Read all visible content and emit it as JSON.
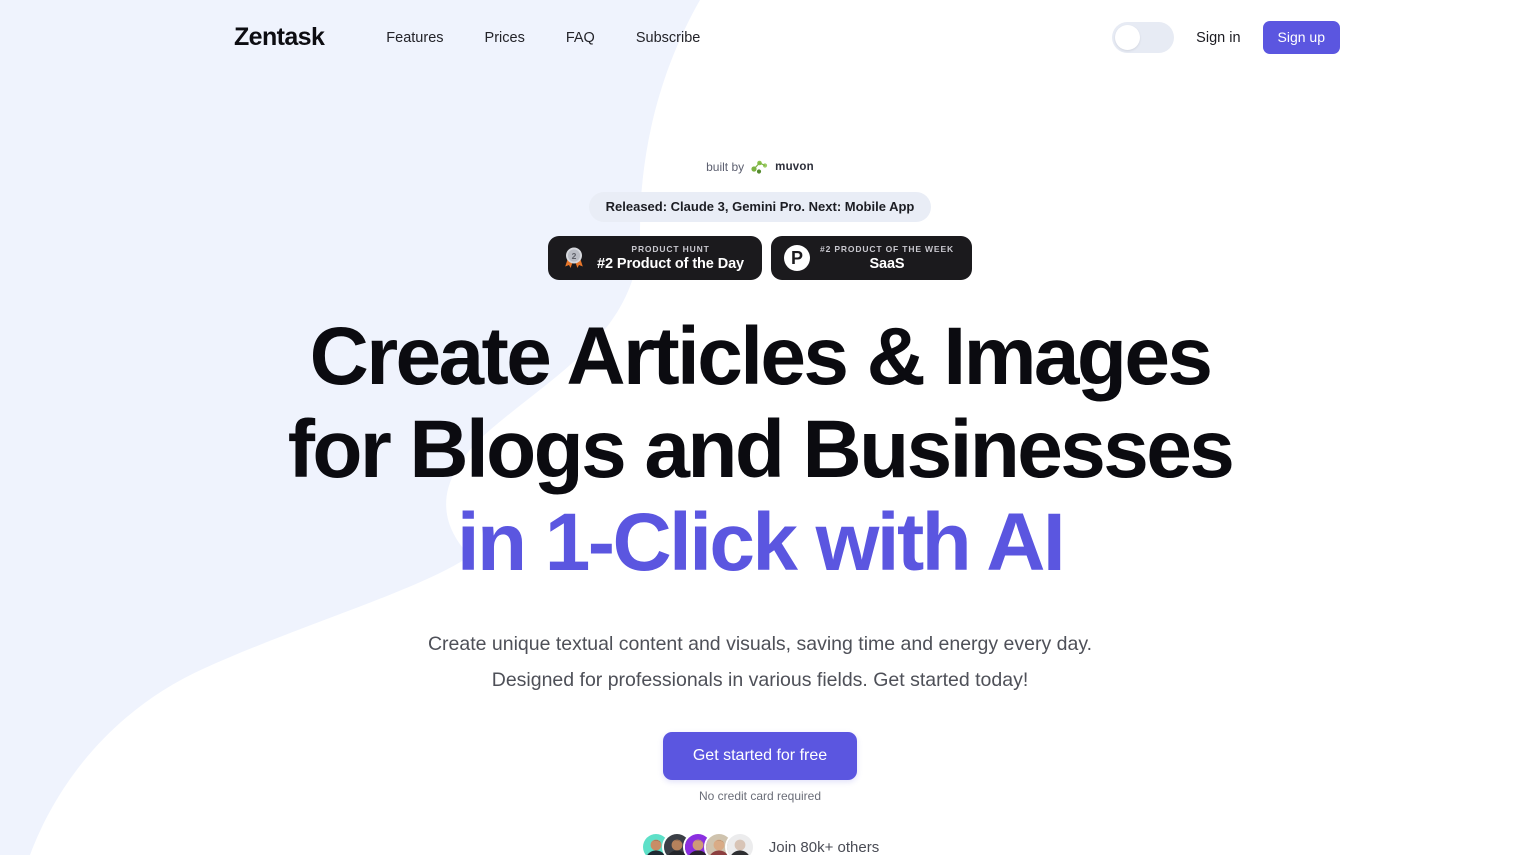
{
  "header": {
    "brand": "Zentask",
    "nav": [
      {
        "label": "Features"
      },
      {
        "label": "Prices"
      },
      {
        "label": "FAQ"
      },
      {
        "label": "Subscribe"
      }
    ],
    "theme_toggle": {
      "icon": "toggle-switch-icon",
      "state": "off"
    },
    "signin_label": "Sign in",
    "signup_label": "Sign up"
  },
  "hero": {
    "built_by_prefix": "built by",
    "built_by_brand": "muvon",
    "built_by_icon": "muvon-logo-icon",
    "release_pill": "Released: Claude 3, Gemini Pro. Next: Mobile App",
    "badges": [
      {
        "icon": "medal-2-icon",
        "kicker": "PRODUCT HUNT",
        "title": "#2 Product of the Day"
      },
      {
        "icon": "product-hunt-logo-icon",
        "logo_letter": "P",
        "kicker": "#2 PRODUCT OF THE WEEK",
        "title": "SaaS"
      }
    ],
    "headline_line1": "Create Articles & Images",
    "headline_line2": "for Blogs and Businesses",
    "headline_line3_accent": "in 1-Click with AI",
    "subtitle_line1": "Create unique textual content and visuals, saving time and energy every day.",
    "subtitle_line2": "Designed for professionals in various fields. Get started today!",
    "cta_label": "Get started for free",
    "cta_note": "No credit card required",
    "join_text": "Join 80k+ others",
    "avatars": [
      {
        "name": "avatar-1",
        "bg": "#5ee0c8",
        "skin": "#c98d66",
        "hair": "#2b2b33",
        "shirt": "#1f2a33"
      },
      {
        "name": "avatar-2",
        "bg": "#3b3f46",
        "skin": "#b5825c",
        "hair": "#1b1b1f",
        "shirt": "#24262b"
      },
      {
        "name": "avatar-3",
        "bg": "#8b2fe0",
        "skin": "#cf9a78",
        "hair": "#5a1b9c",
        "shirt": "#2a2030"
      },
      {
        "name": "avatar-4",
        "bg": "#cfc3ae",
        "skin": "#d9ab86",
        "hair": "#6b5a46",
        "shirt": "#8c3f3f"
      },
      {
        "name": "avatar-5",
        "bg": "#ececed",
        "skin": "#d8c4b6",
        "hair": "#d0cfcd",
        "shirt": "#2e2e31"
      }
    ]
  },
  "theme": {
    "page_background": "#eff3fd",
    "blob_color": "#ffffff",
    "accent": "#5b56e0",
    "badge_background": "#1b1a1d",
    "pill_background": "#e9edf6",
    "text_primary": "#0b0b10",
    "text_muted": "#4e5058"
  }
}
